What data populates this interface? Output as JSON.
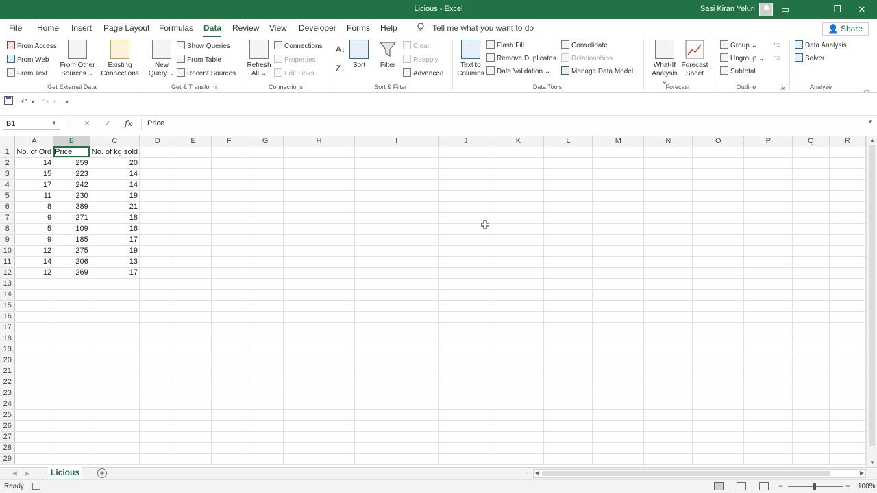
{
  "window": {
    "title": "Licious  -  Excel",
    "user": "Sasi Kiran Yeluri",
    "buttons": {
      "ribbon_display": "▭",
      "minimize": "—",
      "restore": "❐",
      "close": "✕"
    }
  },
  "ribbon_tabs": [
    "File",
    "Home",
    "Insert",
    "Page Layout",
    "Formulas",
    "Data",
    "Review",
    "View",
    "Developer",
    "Forms",
    "Help"
  ],
  "active_tab": "Data",
  "tell_me": "Tell me what you want to do",
  "share": "Share",
  "ribbon": {
    "get_external_data": {
      "label": "Get External Data",
      "from_access": "From Access",
      "from_web": "From Web",
      "from_text": "From Text",
      "from_other_sources_1": "From Other",
      "from_other_sources_2": "Sources",
      "existing_connections_1": "Existing",
      "existing_connections_2": "Connections"
    },
    "get_transform": {
      "label": "Get & Transform",
      "new_query_1": "New",
      "new_query_2": "Query",
      "show_queries": "Show Queries",
      "from_table": "From Table",
      "recent_sources": "Recent Sources"
    },
    "connections": {
      "label": "Connections",
      "refresh_all_1": "Refresh",
      "refresh_all_2": "All",
      "connections": "Connections",
      "properties": "Properties",
      "edit_links": "Edit Links"
    },
    "sort_filter": {
      "label": "Sort & Filter",
      "sort": "Sort",
      "filter": "Filter",
      "clear": "Clear",
      "reapply": "Reapply",
      "advanced": "Advanced"
    },
    "data_tools": {
      "label": "Data Tools",
      "text_to_columns_1": "Text to",
      "text_to_columns_2": "Columns",
      "flash_fill": "Flash Fill",
      "remove_duplicates": "Remove Duplicates",
      "data_validation": "Data Validation",
      "consolidate": "Consolidate",
      "relationships": "Relationships",
      "manage_data_model": "Manage Data Model"
    },
    "forecast": {
      "label": "Forecast",
      "what_if_1": "What-If",
      "what_if_2": "Analysis",
      "forecast_sheet_1": "Forecast",
      "forecast_sheet_2": "Sheet"
    },
    "outline": {
      "label": "Outline",
      "group": "Group",
      "ungroup": "Ungroup",
      "subtotal": "Subtotal"
    },
    "analyze": {
      "label": "Analyze",
      "data_analysis": "Data Analysis",
      "solver": "Solver"
    }
  },
  "formula_bar": {
    "name_box": "B1",
    "cancel": "✕",
    "enter": "✓",
    "fx": "fx",
    "formula": "Price"
  },
  "sheet": {
    "columns": [
      "A",
      "B",
      "C",
      "D",
      "E",
      "F",
      "G",
      "H",
      "I",
      "J",
      "K",
      "L",
      "M",
      "N",
      "O",
      "P",
      "Q",
      "R"
    ],
    "selected_column": "B",
    "active_cell": "B1",
    "headers": [
      "No. of Ord",
      "Price",
      "No. of kg sold"
    ],
    "rows": [
      [
        14,
        259,
        20
      ],
      [
        15,
        223,
        14
      ],
      [
        17,
        242,
        14
      ],
      [
        11,
        230,
        19
      ],
      [
        8,
        389,
        21
      ],
      [
        9,
        271,
        18
      ],
      [
        5,
        109,
        16
      ],
      [
        9,
        185,
        17
      ],
      [
        12,
        275,
        19
      ],
      [
        14,
        206,
        13
      ],
      [
        12,
        269,
        17
      ]
    ],
    "total_rows": 29
  },
  "sheet_tabs": [
    "Licious"
  ],
  "status": {
    "ready": "Ready",
    "zoom": "100%"
  }
}
